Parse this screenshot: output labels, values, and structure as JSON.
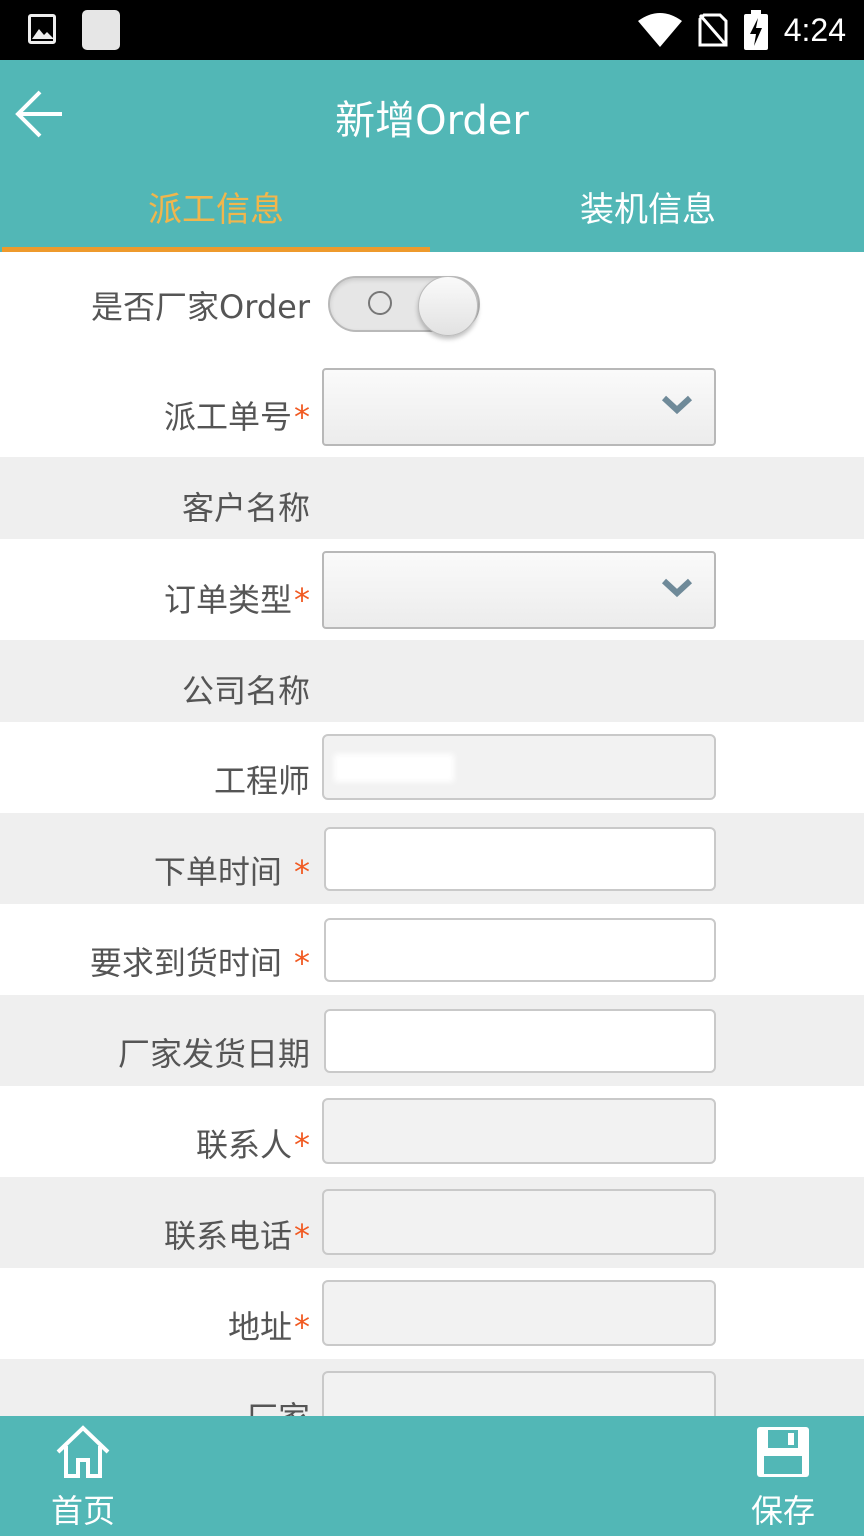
{
  "status_bar": {
    "time": "4:24"
  },
  "app_bar": {
    "title": "新增Order"
  },
  "tabs": [
    {
      "label": "派工信息",
      "active": true
    },
    {
      "label": "装机信息",
      "active": false
    }
  ],
  "form": {
    "manufacturer_order": {
      "label": "是否厂家Order",
      "value": false
    },
    "dispatch_no": {
      "label": "派工单号",
      "required": true,
      "value": ""
    },
    "customer_name": {
      "label": "客户名称"
    },
    "order_type": {
      "label": "订单类型",
      "required": true,
      "value": ""
    },
    "company_name": {
      "label": "公司名称"
    },
    "engineer": {
      "label": "工程师"
    },
    "order_time": {
      "label": "下单时间",
      "required": true,
      "value": ""
    },
    "required_arrival": {
      "label": "要求到货时间",
      "required": true,
      "value": ""
    },
    "ship_date": {
      "label": "厂家发货日期",
      "value": ""
    },
    "contact": {
      "label": "联系人",
      "required": true,
      "value": ""
    },
    "phone": {
      "label": "联系电话",
      "required": true,
      "value": ""
    },
    "address": {
      "label": "地址",
      "required": true,
      "value": ""
    },
    "manufacturer": {
      "label": "厂家",
      "value": ""
    },
    "required_mark": "*"
  },
  "bottom_nav": {
    "home_label": "首页",
    "save_label": "保存"
  },
  "colors": {
    "primary": "#52b7b6",
    "tab_active": "#f1b64c",
    "required": "#f15a22"
  }
}
